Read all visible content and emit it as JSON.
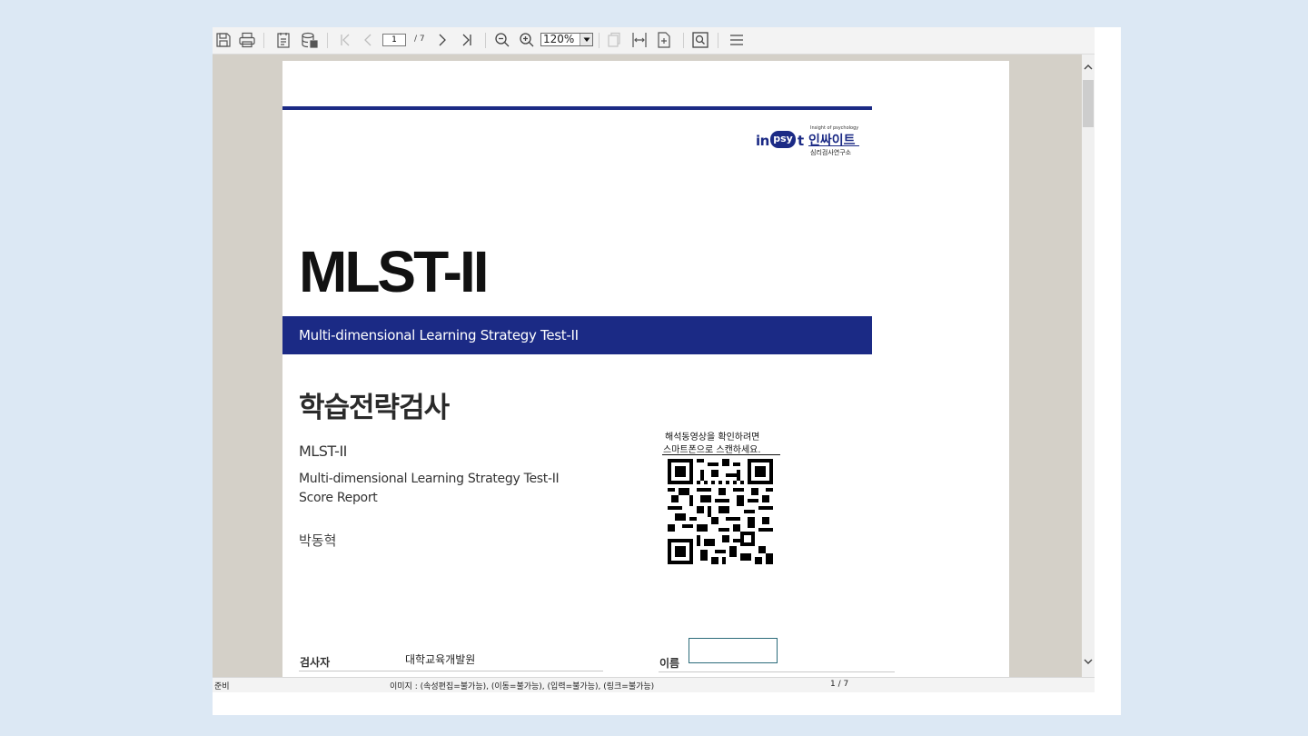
{
  "toolbar": {
    "page_current": "1",
    "page_total": "/ 7",
    "zoom": "120%"
  },
  "document": {
    "logo": {
      "in": "in",
      "psy": "psy",
      "t": "t",
      "tagline": "Insight of psychology",
      "kor_name": "인싸이트",
      "kor_sub": "심리검사연구소"
    },
    "title": "MLST-II",
    "band_text": "Multi-dimensional Learning Strategy Test-II",
    "kor_title": "학습전략검사",
    "abbr": "MLST-II",
    "full_name": "Multi-dimensional Learning Strategy Test-II",
    "report": "Score Report",
    "person_name": "박동혁",
    "qr_caption_1": "해석동영상을 확인하려면",
    "qr_caption_2": "스마트폰으로 스캔하세요.",
    "examiner_label": "검사자",
    "examiner_value": "대학교육개발원",
    "name_label": "이름"
  },
  "statusbar": {
    "ready": "준비",
    "info": "이미지 : (속성편집=불가능), (이동=불가능), (입력=불가능), (링크=불가능)",
    "page": "1 / 7"
  },
  "colors": {
    "brand_navy": "#1b2a85",
    "viewer_bg": "#d4d0c8",
    "outer_bg": "#dce8f4"
  }
}
